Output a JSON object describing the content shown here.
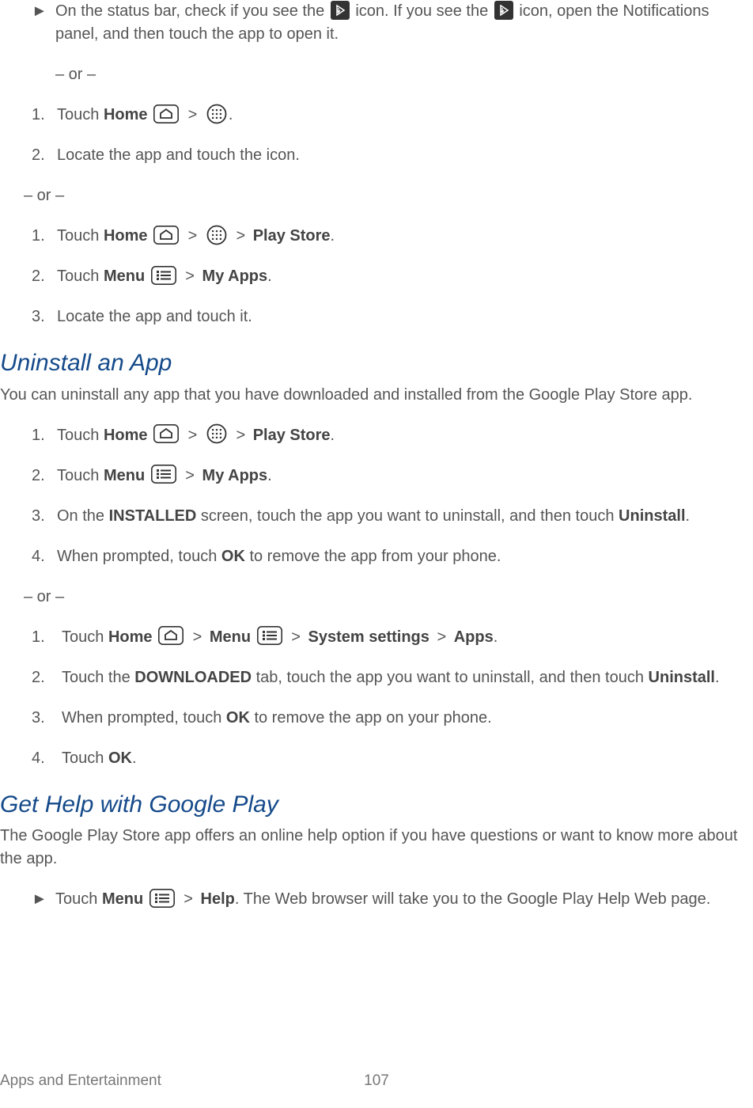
{
  "block1": {
    "bullet_text_a": "On the status bar, check if you see the ",
    "bullet_text_b": " icon. If you see the ",
    "bullet_text_c": " icon, open the Notifications panel, and then touch the app to open it.",
    "or": "– or –"
  },
  "list1": {
    "i1_a": "Touch ",
    "i1_home": "Home",
    "i1_end": ".",
    "i2": "Locate the app and touch the icon."
  },
  "or_sep": "– or –",
  "list2": {
    "i1_a": "Touch ",
    "i1_home": "Home",
    "i1_play": "Play Store",
    "i1_end": ".",
    "i2_a": "Touch ",
    "i2_menu": "Menu",
    "i2_myapps": "My Apps",
    "i2_end": ".",
    "i3": "Locate the app and touch it."
  },
  "uninstall": {
    "heading": "Uninstall an App",
    "intro": "You can uninstall any app that you have downloaded and installed from the Google Play Store app.",
    "i1_a": "Touch ",
    "i1_home": "Home",
    "i1_play": "Play Store",
    "i1_end": ".",
    "i2_a": "Touch ",
    "i2_menu": "Menu",
    "i2_myapps": "My Apps",
    "i2_end": ".",
    "i3_a": "On the ",
    "i3_installed": "INSTALLED",
    "i3_b": " screen, touch the app you want to uninstall, and then touch ",
    "i3_uninstall": "Uninstall",
    "i3_end": ".",
    "i4_a": "When prompted, touch ",
    "i4_ok": "OK",
    "i4_b": " to remove the app from your phone.",
    "or": "– or –",
    "j1_a": "Touch ",
    "j1_home": "Home",
    "j1_menu": "Menu",
    "j1_sys": "System settings",
    "j1_apps": "Apps",
    "j1_end": ".",
    "j2_a": "Touch the ",
    "j2_dl": "DOWNLOADED",
    "j2_b": " tab, touch the app you want to uninstall, and then touch ",
    "j2_un": "Uninstall",
    "j2_end": ".",
    "j3_a": "When prompted, touch ",
    "j3_ok": "OK",
    "j3_b": " to remove the app on your phone.",
    "j4_a": "Touch ",
    "j4_ok": "OK",
    "j4_end": "."
  },
  "help": {
    "heading": "Get Help with Google Play",
    "intro": "The Google Play Store app offers an online help option if you have questions or want to know more about the app.",
    "b_a": "Touch ",
    "b_menu": "Menu",
    "b_help": "Help",
    "b_b": ". The Web browser will take you to the Google Play Help Web page."
  },
  "gt": ">",
  "markers": {
    "triangle": "►",
    "n1": "1.",
    "n2": "2.",
    "n3": "3.",
    "n4": "4."
  },
  "footer": {
    "label": "Apps and Entertainment",
    "page": "107"
  }
}
